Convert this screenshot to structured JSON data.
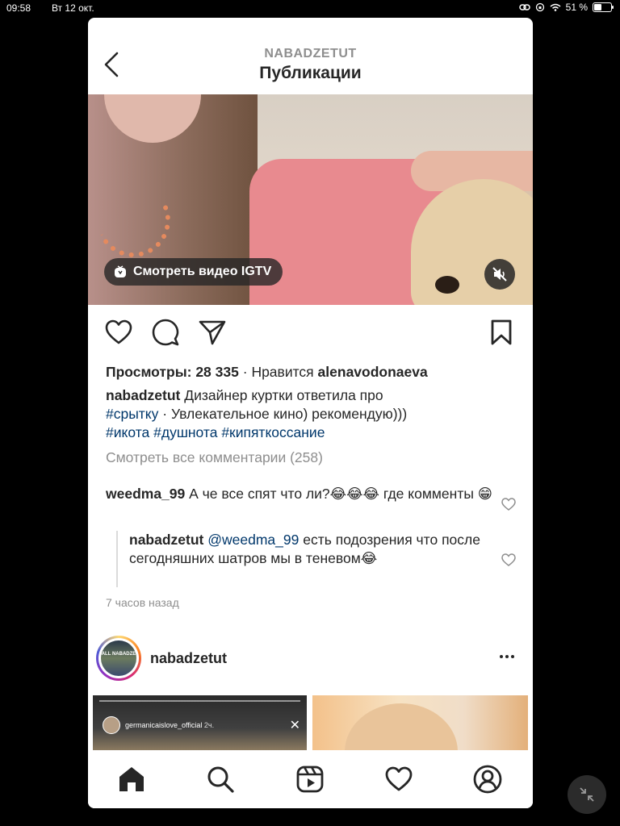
{
  "status_bar": {
    "time": "09:58",
    "date": "Вт 12 окт.",
    "battery": "51 %",
    "battery_level": 0.51
  },
  "header": {
    "username": "NABADZETUT",
    "title": "Публикации"
  },
  "video": {
    "igtv_label": "Смотреть видео IGTV"
  },
  "post": {
    "views_label": "Просмотры: 28 335",
    "separator": "·",
    "liked_prefix": "Нравится",
    "liked_by": "alenavodonaeva",
    "caption_user": "nabadzetut",
    "caption_text_1": "Дизайнер куртки ответила про",
    "caption_tag_1": "#срытку",
    "caption_text_2": "· Увлекательное кино) рекомендую)))",
    "hashtags": [
      "#икота",
      "#душнота",
      "#кипяткоссание"
    ],
    "view_all_comments": "Смотреть все комментарии (258)",
    "comments": [
      {
        "user": "weedma_99",
        "text": "А че все спят что ли?😂😂😂 где комменты 😁"
      },
      {
        "user": "nabadzetut",
        "mention": "@weedma_99",
        "text": "есть подозрения что после сегодняшних шатров мы в теневом😂"
      }
    ],
    "time_ago": "7 часов назад"
  },
  "next_post": {
    "username": "nabadzetut",
    "avatar_text": "ALL NABADZE",
    "story_username": "germanicaislove_official",
    "story_time": "2ч."
  },
  "tabs": [
    "home-tab",
    "search-tab",
    "reels-tab",
    "activity-tab",
    "profile-tab"
  ]
}
